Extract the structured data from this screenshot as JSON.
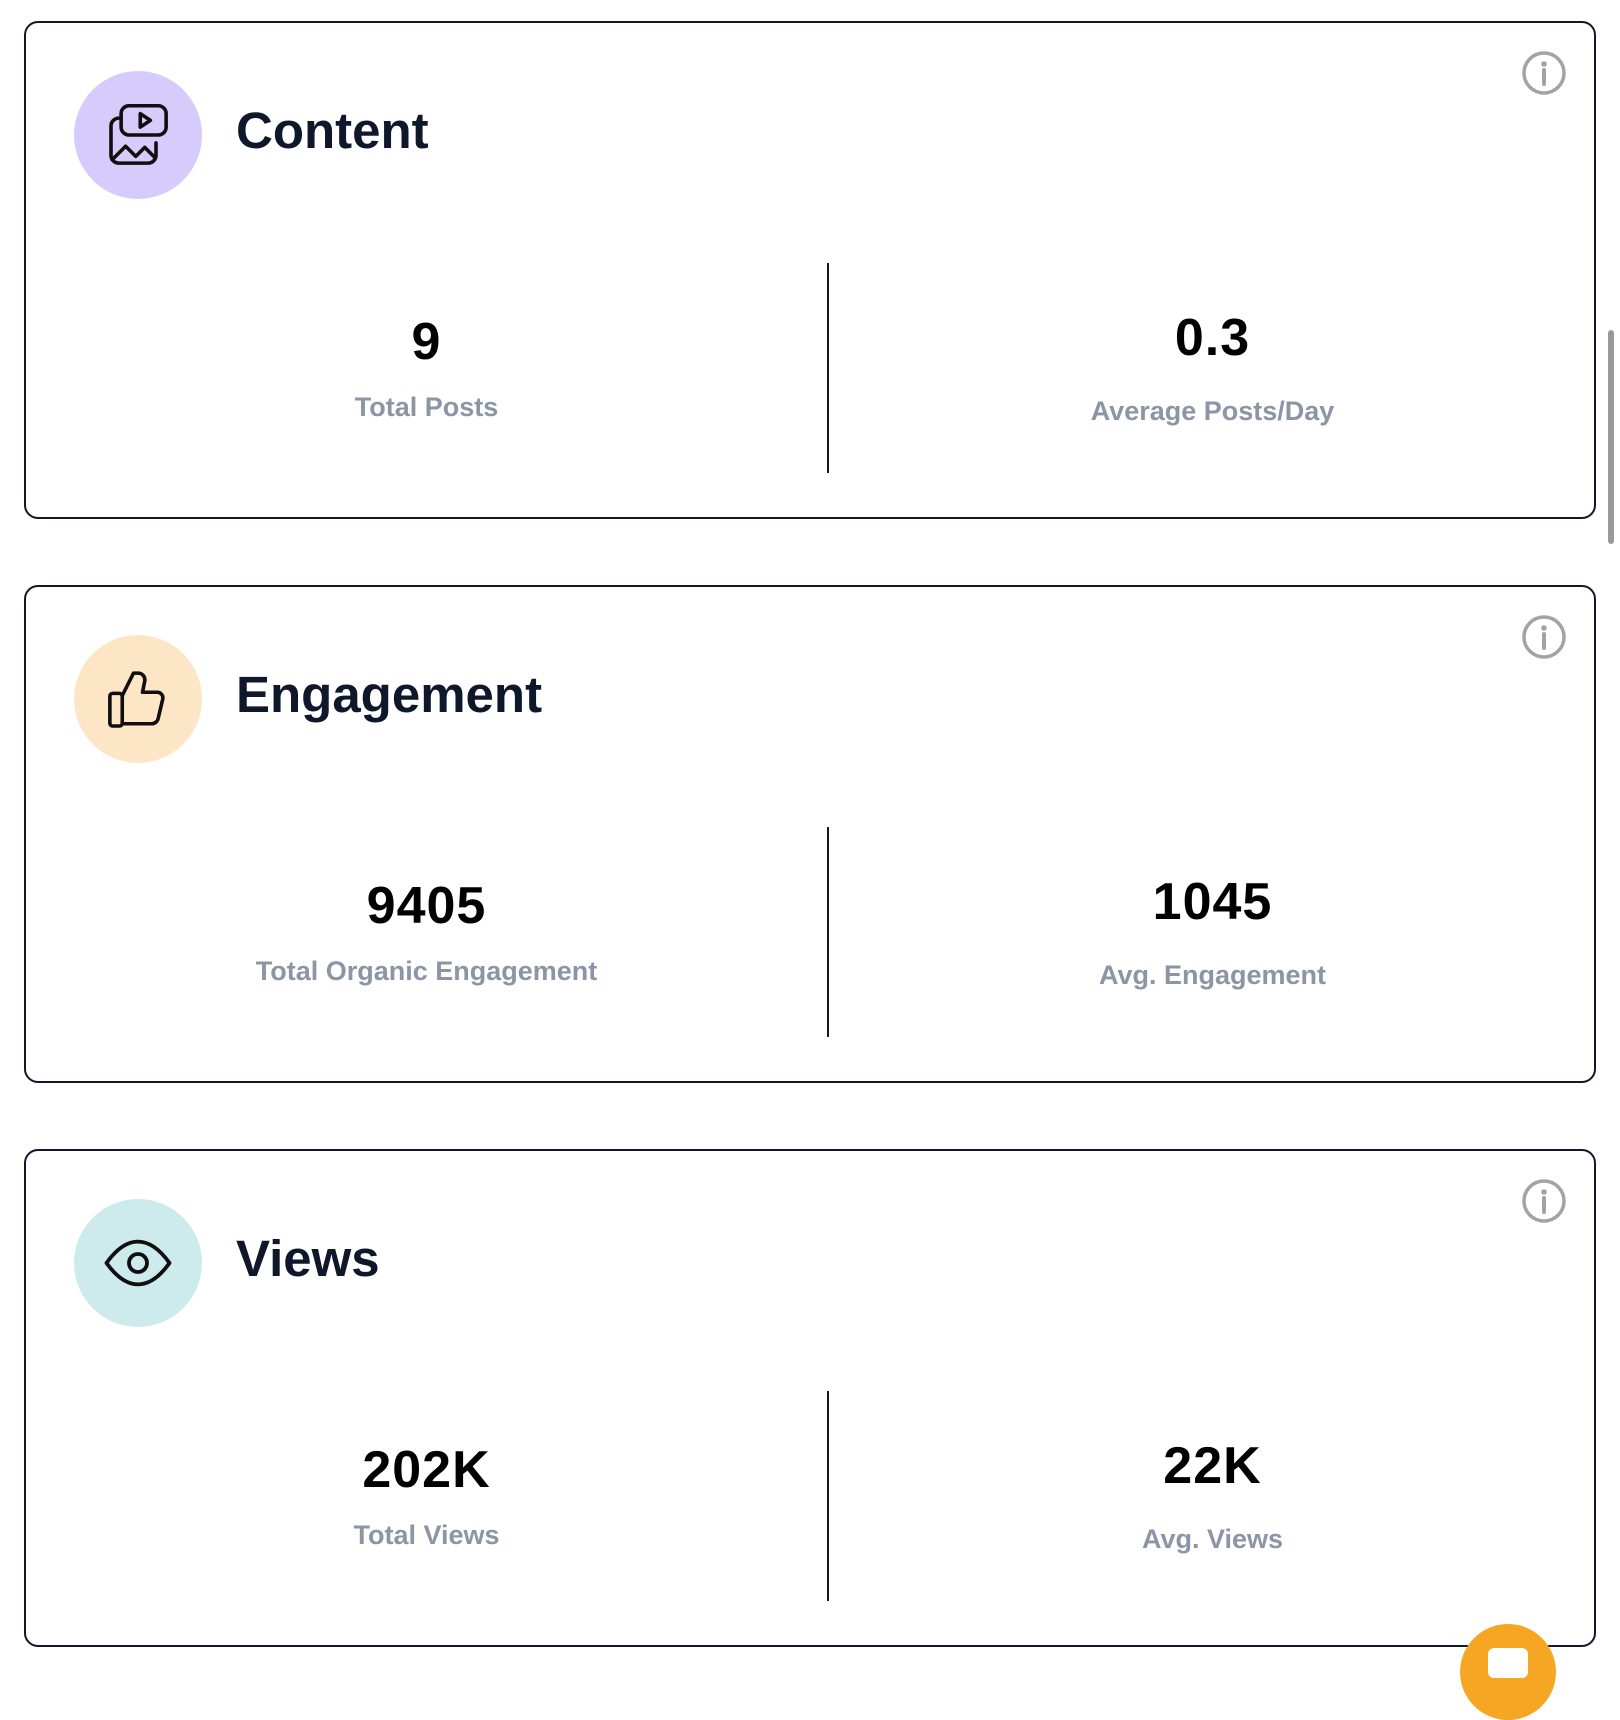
{
  "cards": [
    {
      "title": "Content",
      "icon": "media-image-play-icon",
      "icon_bg": "#d6ccfb",
      "stats": [
        {
          "value": "9",
          "label": "Total Posts"
        },
        {
          "value": "0.3",
          "label": "Average Posts/Day"
        }
      ]
    },
    {
      "title": "Engagement",
      "icon": "thumbs-up-icon",
      "icon_bg": "#fde6c6",
      "stats": [
        {
          "value": "9405",
          "label": "Total Organic Engagement"
        },
        {
          "value": "1045",
          "label": "Avg. Engagement"
        }
      ]
    },
    {
      "title": "Views",
      "icon": "eye-icon",
      "icon_bg": "#cdebec",
      "stats": [
        {
          "value": "202K",
          "label": "Total Views"
        },
        {
          "value": "22K",
          "label": "Avg. Views"
        }
      ]
    }
  ],
  "colors": {
    "border": "#111827",
    "title": "#0f172a",
    "label": "#8b95a6",
    "info_icon": "#a3a3a3",
    "chat_fab": "#f5a623"
  }
}
